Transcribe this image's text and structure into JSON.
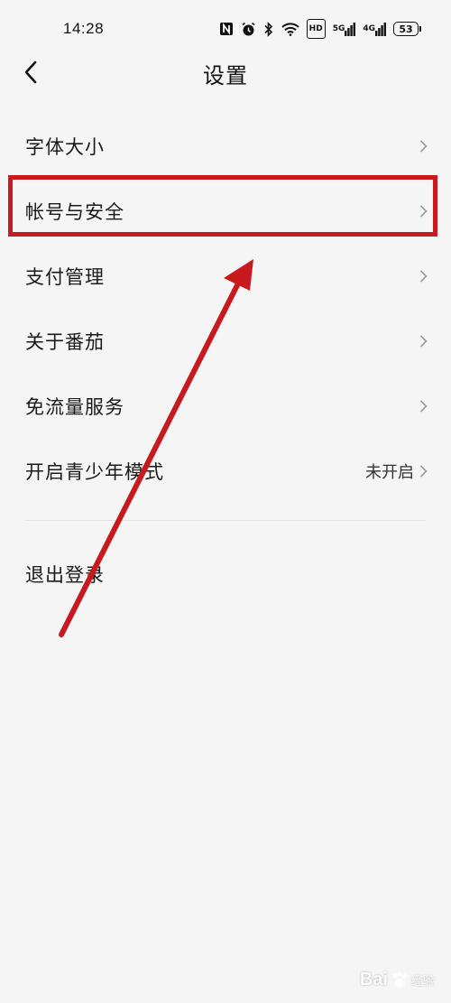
{
  "status_bar": {
    "time": "14:28",
    "network_5g": "5G",
    "network_4g": "4G",
    "hd_label": "HD",
    "battery": "53"
  },
  "header": {
    "title": "设置"
  },
  "menu": {
    "items": [
      {
        "label": "字体大小",
        "value": ""
      },
      {
        "label": "帐号与安全",
        "value": ""
      },
      {
        "label": "支付管理",
        "value": ""
      },
      {
        "label": "关于番茄",
        "value": ""
      },
      {
        "label": "免流量服务",
        "value": ""
      },
      {
        "label": "开启青少年模式",
        "value": "未开启"
      }
    ]
  },
  "logout": {
    "label": "退出登录"
  },
  "annotation": {
    "color": "#c8191f"
  },
  "watermark": {
    "brand": "Bai",
    "sub": "经验"
  }
}
